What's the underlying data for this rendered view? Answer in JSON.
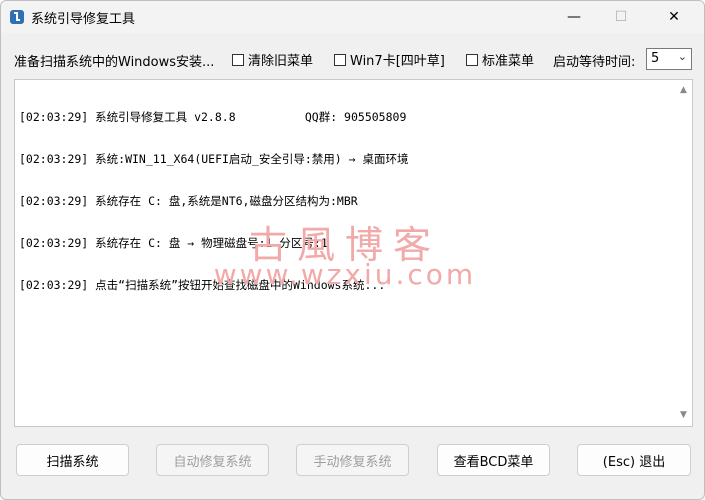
{
  "window": {
    "title": "系统引导修复工具",
    "icon": "wrench-app-icon"
  },
  "titlebar_buttons": {
    "minimize": "—",
    "maximize": "☐",
    "close": "✕"
  },
  "toolbar": {
    "status_label": "准备扫描系统中的Windows安装...",
    "checkbox_clear_old_menu": "清除旧菜单",
    "checkbox_win7_card": "Win7卡[四叶草]",
    "checkbox_standard_menu": "标准菜单",
    "wait_time_label": "启动等待时间:",
    "wait_time_value": "5"
  },
  "log_lines": [
    "[02:03:29] 系统引导修复工具 v2.8.8          QQ群: 905505809",
    "[02:03:29] 系统:WIN_11_X64(UEFI启动_安全引导:禁用) → 桌面环境",
    "[02:03:29] 系统存在 C: 盘,系统是NT6,磁盘分区结构为:MBR",
    "[02:03:29] 系统存在 C: 盘 → 物理磁盘号:1 分区号:1",
    "[02:03:29] 点击“扫描系统”按钮开始查找磁盘中的Windows系统..."
  ],
  "watermark": {
    "line1": "古風博客",
    "line2": "www.wzxiu.com"
  },
  "buttons": {
    "scan": "扫描系统",
    "auto_repair": "自动修复系统",
    "manual_repair": "手动修复系统",
    "view_bcd": "查看BCD菜单",
    "exit": "(Esc) 退出"
  },
  "colors": {
    "watermark": "#f2a9a9",
    "disabled_text": "#9e9e9e",
    "window_bg": "#f0f0f0"
  }
}
